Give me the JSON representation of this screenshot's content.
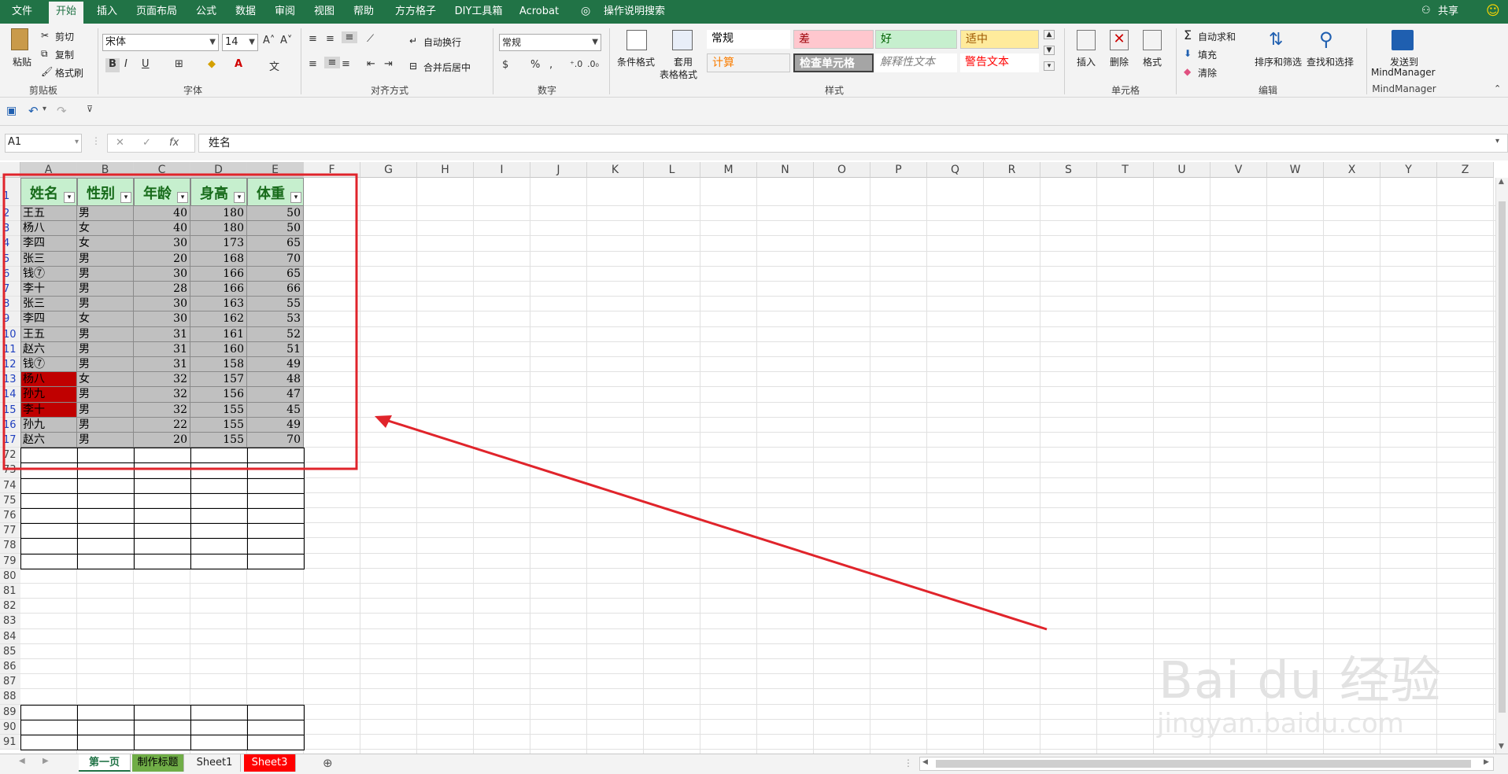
{
  "tabs": [
    "文件",
    "开始",
    "插入",
    "页面布局",
    "公式",
    "数据",
    "审阅",
    "视图",
    "帮助",
    "方方格子",
    "DIY工具箱",
    "Acrobat"
  ],
  "tell_me": "操作说明搜索",
  "share": "共享",
  "clipboard": {
    "paste": "粘贴",
    "cut": "剪切",
    "copy": "复制",
    "format_painter": "格式刷",
    "title": "剪贴板"
  },
  "font": {
    "name": "宋体",
    "size": "14",
    "title": "字体",
    "bold": "B",
    "italic": "I",
    "underline": "U"
  },
  "alignment": {
    "wrap": "自动换行",
    "merge": "合并后居中",
    "title": "对齐方式"
  },
  "number": {
    "format": "常规",
    "title": "数字"
  },
  "styles": {
    "cond_format": "条件格式",
    "table_format_1": "套用",
    "table_format_2": "表格格式",
    "title": "样式",
    "cells": [
      {
        "label": "常规",
        "bg": "#ffffff",
        "color": "#000000"
      },
      {
        "label": "差",
        "bg": "#ffc7ce",
        "color": "#9c0006"
      },
      {
        "label": "好",
        "bg": "#c6efce",
        "color": "#006100"
      },
      {
        "label": "适中",
        "bg": "#ffeb9c",
        "color": "#9c5700"
      },
      {
        "label": "计算",
        "bg": "#f2f2f2",
        "color": "#fa7d00"
      },
      {
        "label": "检查单元格",
        "bg": "#a5a5a5",
        "color": "#ffffff"
      },
      {
        "label": "解释性文本",
        "bg": "#ffffff",
        "color": "#7f7f7f"
      },
      {
        "label": "警告文本",
        "bg": "#ffffff",
        "color": "#ff0000"
      }
    ]
  },
  "cells_group": {
    "insert": "插入",
    "delete": "删除",
    "format": "格式",
    "title": "单元格"
  },
  "editing": {
    "autosum": "自动求和",
    "fill": "填充",
    "clear": "清除",
    "sort": "排序和筛选",
    "find": "查找和选择",
    "title": "编辑"
  },
  "mindmanager": {
    "send": "发送到",
    "name": "MindManager",
    "title": "MindManager"
  },
  "formula_bar": {
    "name_box": "A1",
    "fx": "fx",
    "value": "姓名"
  },
  "columns": [
    "A",
    "B",
    "C",
    "D",
    "E",
    "F",
    "G",
    "H",
    "I",
    "J",
    "K",
    "L",
    "M",
    "N",
    "O",
    "P",
    "Q",
    "R",
    "S",
    "T",
    "U",
    "V",
    "W",
    "X",
    "Y",
    "Z"
  ],
  "row_numbers": [
    "1",
    "2",
    "3",
    "4",
    "5",
    "6",
    "7",
    "8",
    "9",
    "10",
    "11",
    "12",
    "13",
    "14",
    "15",
    "16",
    "17",
    "72",
    "73",
    "74",
    "75",
    "76",
    "77",
    "78",
    "79",
    "80",
    "81",
    "82",
    "83",
    "84",
    "85",
    "86",
    "87",
    "88",
    "89",
    "90",
    "91"
  ],
  "table": {
    "headers": [
      "姓名",
      "性别",
      "年龄",
      "身高",
      "体重"
    ],
    "rows": [
      [
        "王五",
        "男",
        "40",
        "180",
        "50"
      ],
      [
        "杨八",
        "女",
        "40",
        "180",
        "50"
      ],
      [
        "李四",
        "女",
        "30",
        "173",
        "65"
      ],
      [
        "张三",
        "男",
        "20",
        "168",
        "70"
      ],
      [
        "钱⑦",
        "男",
        "30",
        "166",
        "65"
      ],
      [
        "李十",
        "男",
        "28",
        "166",
        "66"
      ],
      [
        "张三",
        "男",
        "30",
        "163",
        "55"
      ],
      [
        "李四",
        "女",
        "30",
        "162",
        "53"
      ],
      [
        "王五",
        "男",
        "31",
        "161",
        "52"
      ],
      [
        "赵六",
        "男",
        "31",
        "160",
        "51"
      ],
      [
        "钱⑦",
        "男",
        "31",
        "158",
        "49"
      ],
      [
        "杨八",
        "女",
        "32",
        "157",
        "48"
      ],
      [
        "孙九",
        "男",
        "32",
        "156",
        "47"
      ],
      [
        "李十",
        "男",
        "32",
        "155",
        "45"
      ],
      [
        "孙九",
        "男",
        "22",
        "155",
        "49"
      ],
      [
        "赵六",
        "男",
        "20",
        "155",
        "70"
      ]
    ],
    "highlighted_name_rows": [
      11,
      12,
      13
    ],
    "highlight_color": "#c00000",
    "row_fill": "#c0c0c0",
    "header_fill": "#c6efce",
    "header_text_color": "#176b1a"
  },
  "sheets": [
    {
      "name": "第一页",
      "bg": "#ffffff",
      "color": "#217346",
      "active": true
    },
    {
      "name": "制作标题",
      "bg": "#70ad47",
      "color": "#000000",
      "active": false
    },
    {
      "name": "Sheet1",
      "bg": "#f3f3f3",
      "color": "#222222",
      "active": false
    },
    {
      "name": "Sheet3",
      "bg": "#ff0000",
      "color": "#ffffff",
      "active": false
    }
  ],
  "watermark": {
    "line1": "Bai du 经验",
    "line2": "jingyan.baidu.com"
  },
  "annotation_color": "#e0242b"
}
